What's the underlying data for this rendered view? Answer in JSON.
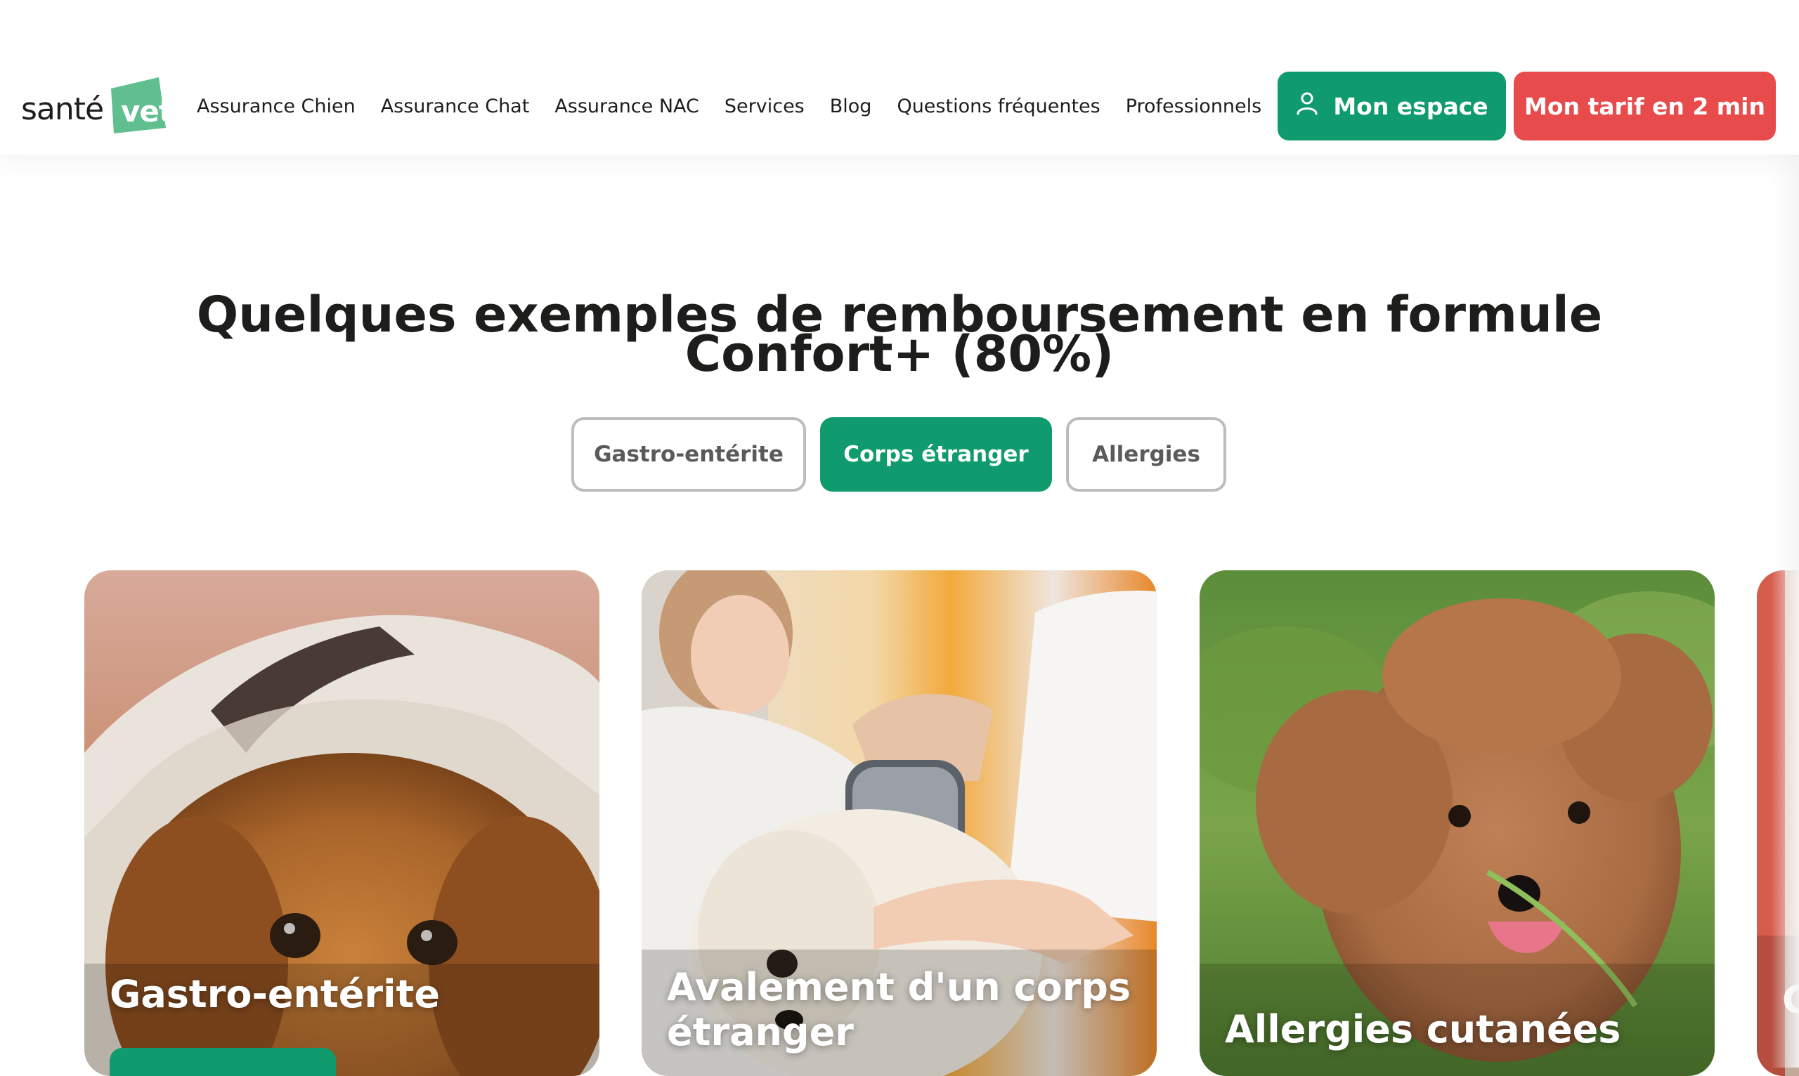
{
  "brand": {
    "logo_word": "santé",
    "logo_badge": "vet",
    "brand_green": "#0f9b6e",
    "brand_red": "#e84b4c"
  },
  "nav": {
    "items": [
      {
        "label": "Assurance Chien"
      },
      {
        "label": "Assurance Chat"
      },
      {
        "label": "Assurance NAC"
      },
      {
        "label": "Services"
      },
      {
        "label": "Blog"
      },
      {
        "label": "Questions fréquentes"
      },
      {
        "label": "Professionnels"
      }
    ],
    "account_button": "Mon espace",
    "account_icon": "user-icon",
    "quote_button": "Mon tarif en 2 min"
  },
  "section": {
    "title": "Quelques exemples de remboursement en formule Confort+ (80%)",
    "tabs": [
      {
        "label": "Gastro-entérite",
        "active": false
      },
      {
        "label": "Corps étranger",
        "active": true
      },
      {
        "label": "Allergies",
        "active": false
      }
    ]
  },
  "cards": [
    {
      "title": "Gastro-entérite",
      "image": "dog-under-blanket-photo"
    },
    {
      "title": "Avalement d'un corps étranger",
      "image": "vet-scanning-white-dog-photo"
    },
    {
      "title": "Allergies cutanées",
      "image": "brown-poodle-in-grass-photo"
    },
    {
      "title": "G",
      "image": "partial-next-card-photo"
    }
  ]
}
